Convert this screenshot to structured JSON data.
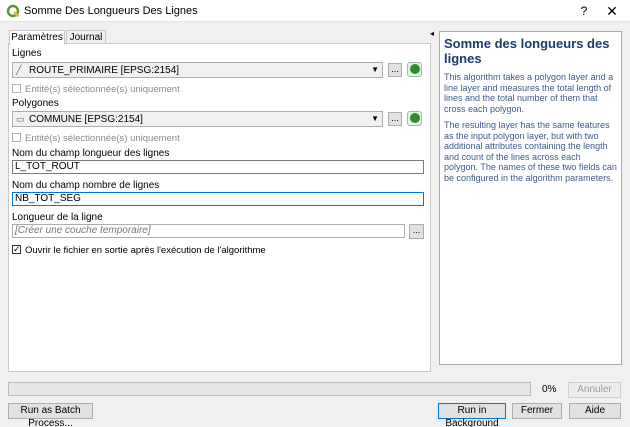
{
  "window": {
    "title": "Somme Des Longueurs Des Lignes",
    "help_glyph": "?",
    "close_glyph": "✕"
  },
  "tabs": [
    {
      "label": "Paramètres"
    },
    {
      "label": "Journal"
    }
  ],
  "params": {
    "lines_label": "Lignes",
    "lines_value": "ROUTE_PRIMAIRE [EPSG:2154]",
    "lines_selected_only": "Entité(s) sélectionnée(s) uniquement",
    "polygons_label": "Polygones",
    "polygons_value": "COMMUNE [EPSG:2154]",
    "polygons_selected_only": "Entité(s) sélectionnée(s) uniquement",
    "length_field_label": "Nom du champ longueur des lignes",
    "length_field_value": "L_TOT_ROUT",
    "count_field_label": "Nom du champ nombre de lignes",
    "count_field_value": "NB_TOT_SEG",
    "output_label": "Longueur de la ligne",
    "output_placeholder": "[Créer une couche temporaire]",
    "open_output": "Ouvrir le fichier en sortie après l'exécution de l'algorithme",
    "browse_label": "..."
  },
  "help": {
    "title": "Somme des longueurs des lignes",
    "p1": "This algorithm takes a polygon layer and a line layer and measures the total length of lines and the total number of them that cross each polygon.",
    "p2": "The resulting layer has the same features as the input polygon layer, but with two additional attributes containing the length and count of the lines across each polygon. The names of these two fields can be configured in the algorithm parameters."
  },
  "footer": {
    "progress_percent": "0%",
    "progress_value": 0,
    "cancel": "Annuler",
    "batch": "Run as Batch Process...",
    "run": "Run in Background",
    "close": "Fermer",
    "help": "Aide"
  },
  "colors": {
    "accent": "#0078d7",
    "help_title": "#1c3c6e",
    "help_text": "#3f5c86",
    "qgis_green": "#589632"
  }
}
